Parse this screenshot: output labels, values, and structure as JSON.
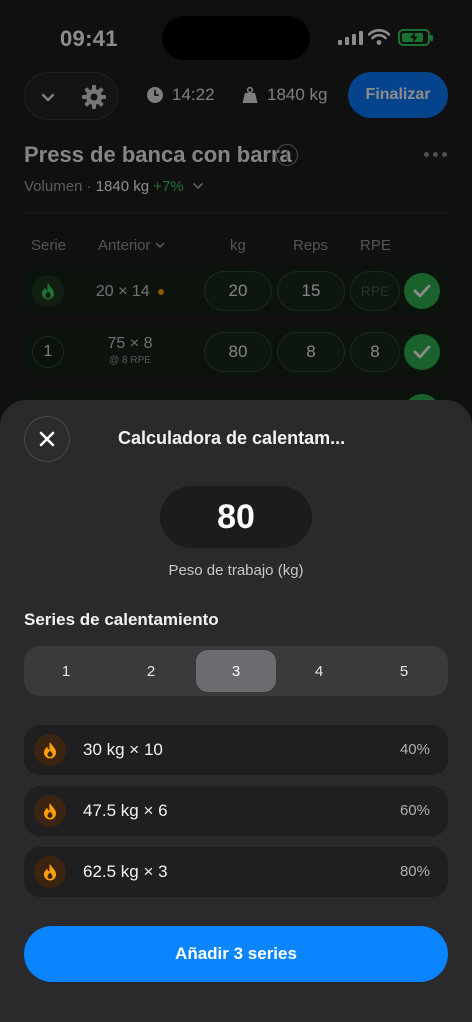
{
  "status": {
    "time": "09:41"
  },
  "toolbar": {
    "timer": "14:22",
    "volume": "1840 kg",
    "finish_label": "Finalizar"
  },
  "exercise": {
    "title": "Press de banca con barra",
    "volume_label": "Volumen · ",
    "volume_value": "1840 kg",
    "volume_delta": " +7%"
  },
  "table": {
    "headers": {
      "set": "Serie",
      "previous": "Anterior",
      "kg": "kg",
      "reps": "Reps",
      "rpe": "RPE"
    },
    "rows": [
      {
        "set": "",
        "previous": "20 × 14",
        "previous_sub": "",
        "kg": "20",
        "reps": "15",
        "rpe": "RPE",
        "done": true
      },
      {
        "set": "1",
        "previous": "75 × 8",
        "previous_sub": "@ 8 RPE",
        "kg": "80",
        "reps": "8",
        "rpe": "8",
        "done": true
      }
    ]
  },
  "sheet": {
    "title": "Calculadora de calentam...",
    "working_weight": "80",
    "working_weight_label": "Peso de trabajo (kg)",
    "section_title": "Series de calentamiento",
    "segments": [
      "1",
      "2",
      "3",
      "4",
      "5"
    ],
    "selected_segment": "3",
    "warmups": [
      {
        "label": "30 kg × 10",
        "percent": "40%"
      },
      {
        "label": "47.5 kg × 6",
        "percent": "60%"
      },
      {
        "label": "62.5 kg × 3",
        "percent": "80%"
      }
    ],
    "add_label": "Añadir 3 series"
  },
  "colors": {
    "accent": "#0a84ff",
    "success": "#30d158",
    "warmup": "#ff9f0a"
  }
}
